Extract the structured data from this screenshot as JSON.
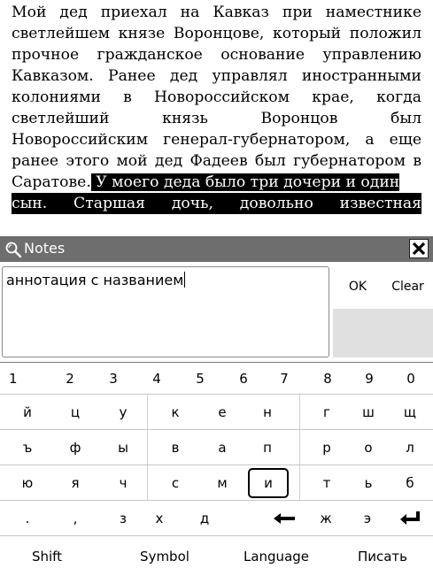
{
  "reader": {
    "lines": [
      "Мой дед приехал на Кавказ при наместнике",
      "светлейшем князе Воронцове, который положил",
      "прочное гражданское основание управлению",
      "Кавказом. Ранее дед управлял иностранными",
      "колониями в Новороссийском крае, когда",
      "светлейший князь Воронцов был",
      "Новороссийским генерал-губернатором, а еще",
      "ранее этого мой дед Фадеев был губернатором в"
    ],
    "line9_plain": "Саратове.",
    "line9_highlight": " У моего деда было три дочери и один",
    "line10_highlight": "сын. Старшая дочь, довольно известная"
  },
  "notes": {
    "title": "Notes",
    "close_glyph": "✕",
    "input_value": "аннотация с названием",
    "ok_label": "OK",
    "clear_label": "Clear"
  },
  "keyboard": {
    "digits": [
      "1",
      "2",
      "3",
      "4",
      "5",
      "6",
      "7",
      "8",
      "9",
      "0"
    ],
    "row1": [
      "й",
      "ц",
      "у",
      "к",
      "е",
      "н",
      "г",
      "ш",
      "щ"
    ],
    "row2": [
      "ъ",
      "ф",
      "ы",
      "в",
      "а",
      "п",
      "р",
      "о",
      "л"
    ],
    "row3": [
      "ю",
      "я",
      "ч",
      "с",
      "м",
      "и",
      "т",
      "ь",
      "б"
    ],
    "row4": [
      ".",
      ",",
      "з",
      "х",
      "д",
      "←",
      "ж",
      "э",
      "↵"
    ],
    "bottom": [
      "Shift",
      "Symbol",
      "Language",
      "Писать"
    ],
    "selected_key": "и"
  }
}
